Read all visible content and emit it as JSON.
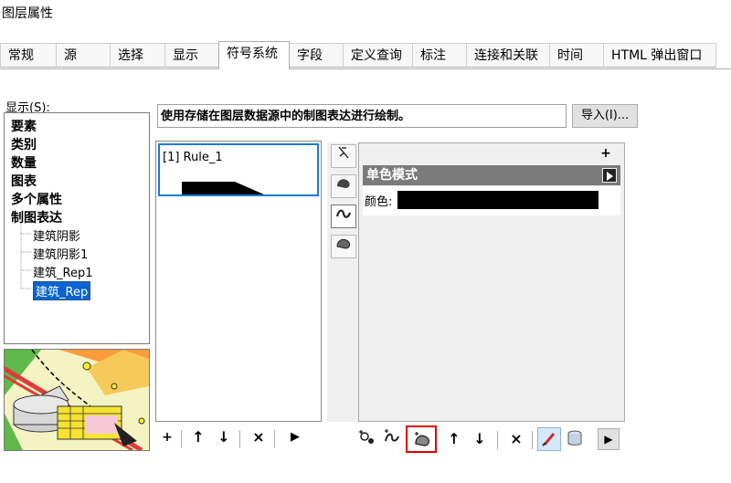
{
  "window": {
    "title": "图层属性"
  },
  "tabs": [
    {
      "label": "常规"
    },
    {
      "label": "源"
    },
    {
      "label": "选择"
    },
    {
      "label": "显示"
    },
    {
      "label": "符号系统"
    },
    {
      "label": "字段"
    },
    {
      "label": "定义查询"
    },
    {
      "label": "标注"
    },
    {
      "label": "连接和关联"
    },
    {
      "label": "时间"
    },
    {
      "label": "HTML 弹出窗口"
    }
  ],
  "active_tab": "符号系统",
  "show": {
    "label": "显示(S):",
    "categories": [
      "要素",
      "类别",
      "数量",
      "图表",
      "多个属性",
      "制图表达"
    ],
    "representations": [
      "建筑阴影",
      "建筑阴影1",
      "建筑_Rep1",
      "建筑_Rep"
    ],
    "selected": "建筑_Rep"
  },
  "description": "使用存储在图层数据源中的制图表达进行绘制。",
  "import_button": "导入(I)...",
  "rules": [
    {
      "label": "[1] Rule_1"
    }
  ],
  "properties": {
    "plus": "+",
    "section_title": "单色模式",
    "color_label": "颜色:",
    "color_value": "#000000"
  },
  "rule_toolbar": {
    "add": "+",
    "up": "↑",
    "down": "↓",
    "remove": "×",
    "more": "▶"
  },
  "layer_toolbar": {
    "up": "↑",
    "down": "↓",
    "remove": "×",
    "more": "▶"
  },
  "colors": {
    "accent": "#1e7bd1",
    "highlight_box": "#e00000",
    "selection": "#0a64d2"
  }
}
